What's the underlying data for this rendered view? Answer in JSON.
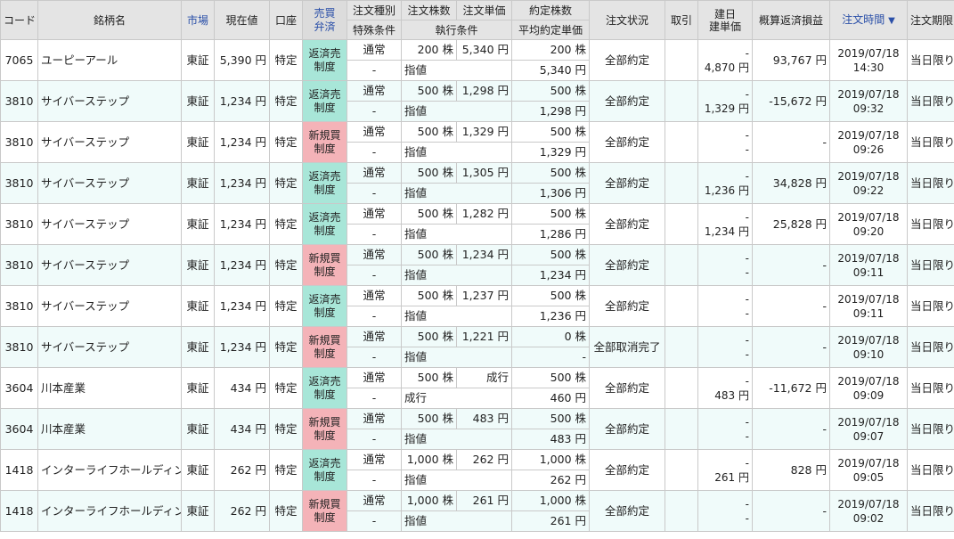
{
  "headers": {
    "code": "コード",
    "name": "銘柄名",
    "market": "市場",
    "price": "現在値",
    "account": "口座",
    "side_line1": "売買",
    "side_line2": "弁済",
    "order_type": "注文種別",
    "special": "特殊条件",
    "qty": "注文株数",
    "unit_price": "注文単価",
    "exec_cond": "執行条件",
    "filled_qty": "約定株数",
    "avg_price": "平均約定単価",
    "status": "注文状況",
    "trade": "取引",
    "open_line1": "建日",
    "open_line2": "建単価",
    "pnl": "概算返済損益",
    "order_time": "注文時間",
    "sort_arrow": "▼",
    "expiry": "注文期限"
  },
  "rows": [
    {
      "code": "7065",
      "name": "ユーピーアール",
      "market": "東証",
      "price": "5,390 円",
      "account": "特定",
      "side1": "返済売",
      "side2": "制度",
      "side_kind": "close",
      "order_type": "通常",
      "special": "-",
      "qty": "200 株",
      "unit_price": "5,340 円",
      "exec": "指値",
      "filled": "200 株",
      "avg": "5,340 円",
      "status": "全部約定",
      "trade": "",
      "open1": "-",
      "open2": "4,870 円",
      "pnl": "93,767 円",
      "date": "2019/07/18",
      "time": "14:30",
      "expiry": "当日限り"
    },
    {
      "code": "3810",
      "name": "サイバーステップ",
      "market": "東証",
      "price": "1,234 円",
      "account": "特定",
      "side1": "返済売",
      "side2": "制度",
      "side_kind": "close",
      "order_type": "通常",
      "special": "-",
      "qty": "500 株",
      "unit_price": "1,298 円",
      "exec": "指値",
      "filled": "500 株",
      "avg": "1,298 円",
      "status": "全部約定",
      "trade": "",
      "open1": "-",
      "open2": "1,329 円",
      "pnl": "-15,672 円",
      "date": "2019/07/18",
      "time": "09:32",
      "expiry": "当日限り"
    },
    {
      "code": "3810",
      "name": "サイバーステップ",
      "market": "東証",
      "price": "1,234 円",
      "account": "特定",
      "side1": "新規買",
      "side2": "制度",
      "side_kind": "open",
      "order_type": "通常",
      "special": "-",
      "qty": "500 株",
      "unit_price": "1,329 円",
      "exec": "指値",
      "filled": "500 株",
      "avg": "1,329 円",
      "status": "全部約定",
      "trade": "",
      "open1": "-",
      "open2": "-",
      "pnl": "-",
      "date": "2019/07/18",
      "time": "09:26",
      "expiry": "当日限り"
    },
    {
      "code": "3810",
      "name": "サイバーステップ",
      "market": "東証",
      "price": "1,234 円",
      "account": "特定",
      "side1": "返済売",
      "side2": "制度",
      "side_kind": "close",
      "order_type": "通常",
      "special": "-",
      "qty": "500 株",
      "unit_price": "1,305 円",
      "exec": "指値",
      "filled": "500 株",
      "avg": "1,306 円",
      "status": "全部約定",
      "trade": "",
      "open1": "-",
      "open2": "1,236 円",
      "pnl": "34,828 円",
      "date": "2019/07/18",
      "time": "09:22",
      "expiry": "当日限り"
    },
    {
      "code": "3810",
      "name": "サイバーステップ",
      "market": "東証",
      "price": "1,234 円",
      "account": "特定",
      "side1": "返済売",
      "side2": "制度",
      "side_kind": "close",
      "order_type": "通常",
      "special": "-",
      "qty": "500 株",
      "unit_price": "1,282 円",
      "exec": "指値",
      "filled": "500 株",
      "avg": "1,286 円",
      "status": "全部約定",
      "trade": "",
      "open1": "-",
      "open2": "1,234 円",
      "pnl": "25,828 円",
      "date": "2019/07/18",
      "time": "09:20",
      "expiry": "当日限り"
    },
    {
      "code": "3810",
      "name": "サイバーステップ",
      "market": "東証",
      "price": "1,234 円",
      "account": "特定",
      "side1": "新規買",
      "side2": "制度",
      "side_kind": "open",
      "order_type": "通常",
      "special": "-",
      "qty": "500 株",
      "unit_price": "1,234 円",
      "exec": "指値",
      "filled": "500 株",
      "avg": "1,234 円",
      "status": "全部約定",
      "trade": "",
      "open1": "-",
      "open2": "-",
      "pnl": "-",
      "date": "2019/07/18",
      "time": "09:11",
      "expiry": "当日限り"
    },
    {
      "code": "3810",
      "name": "サイバーステップ",
      "market": "東証",
      "price": "1,234 円",
      "account": "特定",
      "side1": "返済売",
      "side2": "制度",
      "side_kind": "close",
      "order_type": "通常",
      "special": "-",
      "qty": "500 株",
      "unit_price": "1,237 円",
      "exec": "指値",
      "filled": "500 株",
      "avg": "1,236 円",
      "status": "全部約定",
      "trade": "",
      "open1": "-",
      "open2": "-",
      "pnl": "-",
      "date": "2019/07/18",
      "time": "09:11",
      "expiry": "当日限り"
    },
    {
      "code": "3810",
      "name": "サイバーステップ",
      "market": "東証",
      "price": "1,234 円",
      "account": "特定",
      "side1": "新規買",
      "side2": "制度",
      "side_kind": "open",
      "order_type": "通常",
      "special": "-",
      "qty": "500 株",
      "unit_price": "1,221 円",
      "exec": "指値",
      "filled": "0 株",
      "avg": "-",
      "status": "全部取消完了",
      "trade": "",
      "open1": "-",
      "open2": "-",
      "pnl": "-",
      "date": "2019/07/18",
      "time": "09:10",
      "expiry": "当日限り"
    },
    {
      "code": "3604",
      "name": "川本産業",
      "market": "東証",
      "price": "434 円",
      "account": "特定",
      "side1": "返済売",
      "side2": "制度",
      "side_kind": "close",
      "order_type": "通常",
      "special": "-",
      "qty": "500 株",
      "unit_price": "成行",
      "exec": "成行",
      "filled": "500 株",
      "avg": "460 円",
      "status": "全部約定",
      "trade": "",
      "open1": "-",
      "open2": "483 円",
      "pnl": "-11,672 円",
      "date": "2019/07/18",
      "time": "09:09",
      "expiry": "当日限り"
    },
    {
      "code": "3604",
      "name": "川本産業",
      "market": "東証",
      "price": "434 円",
      "account": "特定",
      "side1": "新規買",
      "side2": "制度",
      "side_kind": "open",
      "order_type": "通常",
      "special": "-",
      "qty": "500 株",
      "unit_price": "483 円",
      "exec": "指値",
      "filled": "500 株",
      "avg": "483 円",
      "status": "全部約定",
      "trade": "",
      "open1": "-",
      "open2": "-",
      "pnl": "-",
      "date": "2019/07/18",
      "time": "09:07",
      "expiry": "当日限り"
    },
    {
      "code": "1418",
      "name": "インターライフホールディング",
      "market": "東証",
      "price": "262 円",
      "account": "特定",
      "side1": "返済売",
      "side2": "制度",
      "side_kind": "close",
      "order_type": "通常",
      "special": "-",
      "qty": "1,000 株",
      "unit_price": "262 円",
      "exec": "指値",
      "filled": "1,000 株",
      "avg": "262 円",
      "status": "全部約定",
      "trade": "",
      "open1": "-",
      "open2": "261 円",
      "pnl": "828 円",
      "date": "2019/07/18",
      "time": "09:05",
      "expiry": "当日限り"
    },
    {
      "code": "1418",
      "name": "インターライフホールディング",
      "market": "東証",
      "price": "262 円",
      "account": "特定",
      "side1": "新規買",
      "side2": "制度",
      "side_kind": "open",
      "order_type": "通常",
      "special": "-",
      "qty": "1,000 株",
      "unit_price": "261 円",
      "exec": "指値",
      "filled": "1,000 株",
      "avg": "261 円",
      "status": "全部約定",
      "trade": "",
      "open1": "-",
      "open2": "-",
      "pnl": "-",
      "date": "2019/07/18",
      "time": "09:02",
      "expiry": "当日限り"
    }
  ]
}
